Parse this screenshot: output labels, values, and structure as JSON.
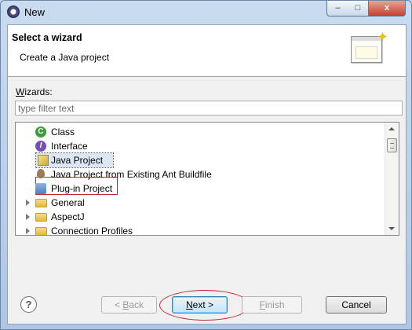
{
  "window": {
    "title": "New"
  },
  "titlebar_buttons": {
    "minimize": "–",
    "maximize": "□",
    "close": "x"
  },
  "banner": {
    "title": "Select a wizard",
    "description": "Create a Java project"
  },
  "wizards": {
    "label_underlined": "W",
    "label_rest": "izards:",
    "filter_placeholder": "type filter text",
    "filter_value": ""
  },
  "tree": {
    "items": [
      {
        "label": "Class",
        "icon": "class-icon",
        "expandable": false
      },
      {
        "label": "Interface",
        "icon": "interface-icon",
        "expandable": false
      },
      {
        "label": "Java Project",
        "icon": "java-project-icon",
        "expandable": false,
        "selected": true
      },
      {
        "label": "Java Project from Existing Ant Buildfile",
        "icon": "ant-icon",
        "expandable": false
      },
      {
        "label": "Plug-in Project",
        "icon": "plugin-icon",
        "expandable": false
      },
      {
        "label": "General",
        "icon": "folder-icon",
        "expandable": true
      },
      {
        "label": "AspectJ",
        "icon": "folder-icon",
        "expandable": true
      },
      {
        "label": "Connection Profiles",
        "icon": "folder-icon",
        "expandable": true
      }
    ]
  },
  "buttons": {
    "help": "?",
    "back_underlined": "< ",
    "back_mnemonic": "B",
    "back_rest": "ack",
    "next_mnemonic": "N",
    "next_rest": "ext >",
    "finish_mnemonic": "F",
    "finish_rest": "inish",
    "cancel": "Cancel"
  },
  "colors": {
    "annotation_red": "#c4262e",
    "selection": "#dbe7f5"
  }
}
